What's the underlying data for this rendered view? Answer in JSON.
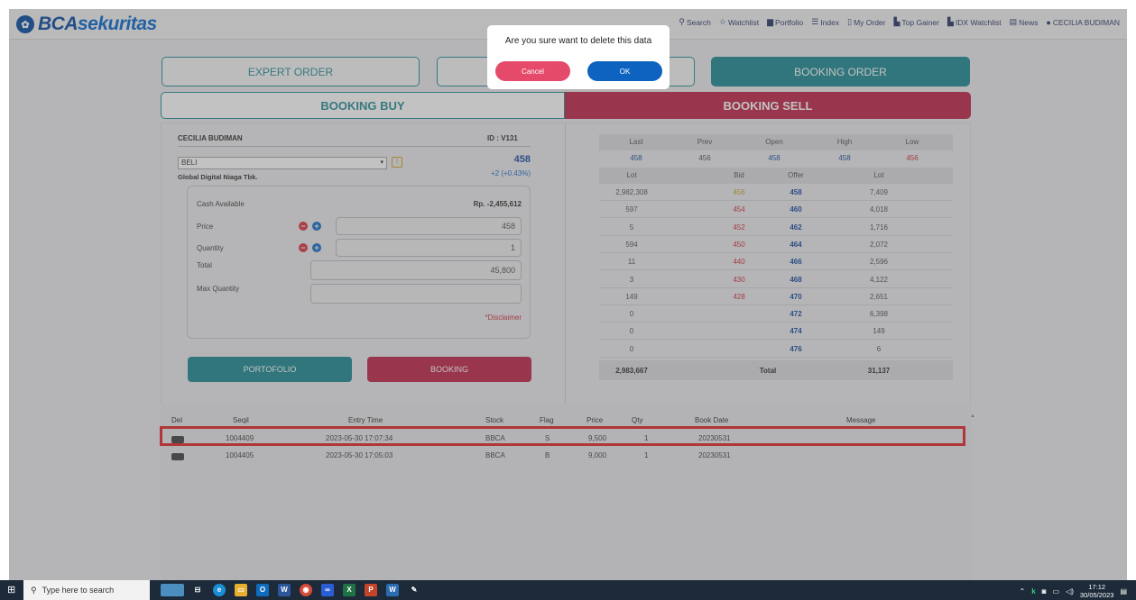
{
  "header": {
    "logo_text_a": "BCA",
    "logo_text_b": "sekuritas",
    "nav": [
      {
        "icon": "search-icon",
        "glyph": "⚲",
        "label": "Search"
      },
      {
        "icon": "star-icon",
        "glyph": "☆",
        "label": "Watchlist"
      },
      {
        "icon": "briefcase-icon",
        "glyph": "▆",
        "label": "Portfolio"
      },
      {
        "icon": "list-icon",
        "glyph": "☰",
        "label": "Index"
      },
      {
        "icon": "clipboard-icon",
        "glyph": "▯",
        "label": "My Order"
      },
      {
        "icon": "chart-icon",
        "glyph": "▙",
        "label": "Top Gainer"
      },
      {
        "icon": "chart-icon",
        "glyph": "▙",
        "label": "IDX Watchlist"
      },
      {
        "icon": "newspaper-icon",
        "glyph": "▤",
        "label": "News"
      }
    ],
    "user": "CECILIA BUDIMAN"
  },
  "tabs": {
    "expert_order": "EXPERT ORDER",
    "booking_order": "BOOKING ORDER"
  },
  "subtabs": {
    "buy": "BOOKING BUY",
    "sell": "BOOKING SELL"
  },
  "order_form": {
    "client_name": "CECILIA BUDIMAN",
    "client_id": "ID : V131",
    "side_select": "BELI",
    "stock_name": "Global Digital Niaga Tbk.",
    "price_big": "458",
    "change": "+2 (+0.43%)",
    "cash_label": "Cash Available",
    "cash_value": "Rp. -2,455,612",
    "price_label": "Price",
    "price_value": "458",
    "qty_label": "Quantity",
    "qty_value": "1",
    "total_label": "Total",
    "total_value": "45,800",
    "maxqty_label": "Max Quantity",
    "maxqty_value": "",
    "disclaimer": "*Disclaimer",
    "portfolio_btn": "PORTOFOLIO",
    "booking_btn": "BOOKING"
  },
  "quote": {
    "headers": [
      "Last",
      "Prev",
      "Open",
      "High",
      "Low"
    ],
    "values": [
      "458",
      "456",
      "458",
      "458",
      "456"
    ],
    "book_headers": [
      "Lot",
      "Bid",
      "Offer",
      "Lot"
    ],
    "rows": [
      {
        "bid_lot": "2,982,308",
        "bid": "456",
        "offer": "458",
        "offer_lot": "7,409",
        "bid_color": "gold"
      },
      {
        "bid_lot": "597",
        "bid": "454",
        "offer": "460",
        "offer_lot": "4,018",
        "bid_color": "red"
      },
      {
        "bid_lot": "5",
        "bid": "452",
        "offer": "462",
        "offer_lot": "1,716",
        "bid_color": "red"
      },
      {
        "bid_lot": "594",
        "bid": "450",
        "offer": "464",
        "offer_lot": "2,072",
        "bid_color": "red"
      },
      {
        "bid_lot": "11",
        "bid": "440",
        "offer": "466",
        "offer_lot": "2,596",
        "bid_color": "red"
      },
      {
        "bid_lot": "3",
        "bid": "430",
        "offer": "468",
        "offer_lot": "4,122",
        "bid_color": "red"
      },
      {
        "bid_lot": "149",
        "bid": "428",
        "offer": "470",
        "offer_lot": "2,651",
        "bid_color": "red"
      },
      {
        "bid_lot": "0",
        "bid": "",
        "offer": "472",
        "offer_lot": "6,398",
        "bid_color": "red"
      },
      {
        "bid_lot": "0",
        "bid": "",
        "offer": "474",
        "offer_lot": "149",
        "bid_color": "red"
      },
      {
        "bid_lot": "0",
        "bid": "",
        "offer": "476",
        "offer_lot": "6",
        "bid_color": "red"
      }
    ],
    "total_bid_lot": "2,983,667",
    "total_label": "Total",
    "total_offer_lot": "31,137"
  },
  "orders": {
    "headers": [
      "Del",
      "Seqil",
      "Entry Time",
      "Stock",
      "Flag",
      "Price",
      "Qty",
      "Book Date",
      "Message"
    ],
    "rows": [
      {
        "seq": "1004409",
        "time": "2023-05-30 17:07:34",
        "stock": "BBCA",
        "flag": "S",
        "price": "9,500",
        "qty": "1",
        "date": "20230531",
        "message": ""
      },
      {
        "seq": "1004405",
        "time": "2023-05-30 17:05:03",
        "stock": "BBCA",
        "flag": "B",
        "price": "9,000",
        "qty": "1",
        "date": "20230531",
        "message": ""
      }
    ]
  },
  "dialog": {
    "message": "Are you sure want to delete this data",
    "cancel": "Cancel",
    "ok": "OK"
  },
  "taskbar": {
    "search_placeholder": "Type here to search",
    "time": "17:12",
    "date": "30/05/2023"
  },
  "colors": {
    "teal": "#1f8b94",
    "crimson": "#c0284c",
    "brand_blue": "#0a4ea2"
  }
}
